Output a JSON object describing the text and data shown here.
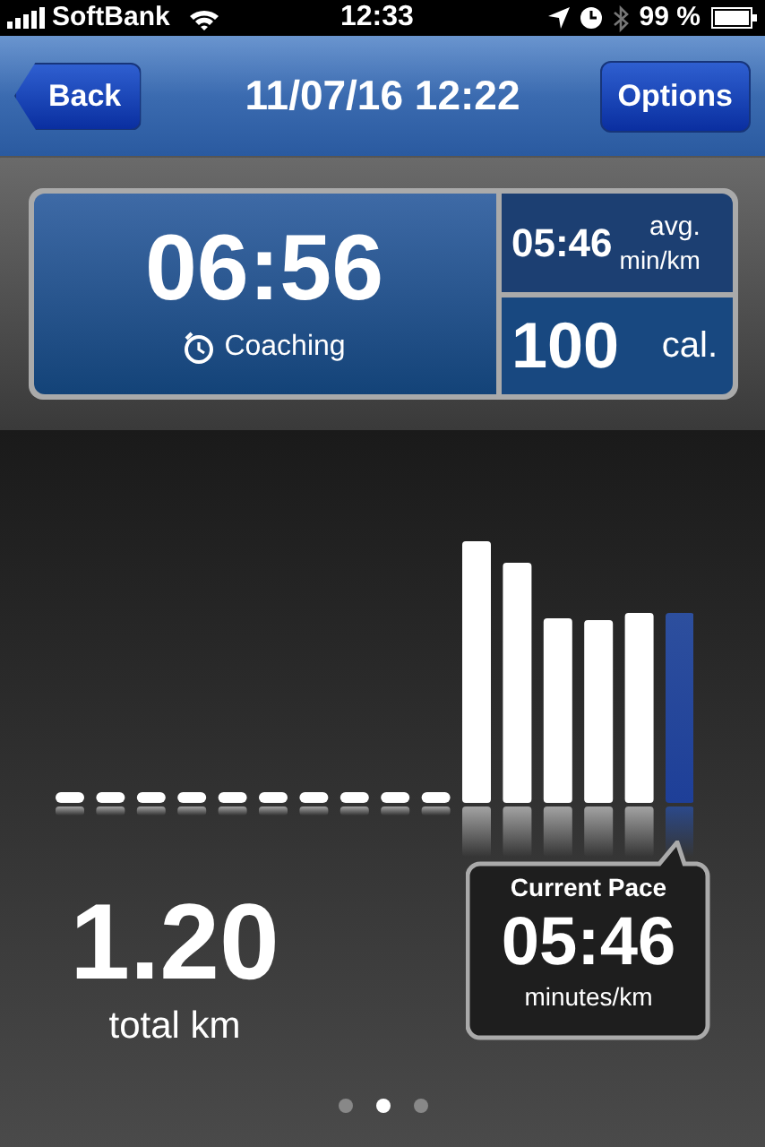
{
  "status_bar": {
    "carrier": "SoftBank",
    "time": "12:33",
    "battery": "99 %"
  },
  "nav_bar": {
    "back": "Back",
    "title": "11/07/16 12:22",
    "options": "Options"
  },
  "summary": {
    "duration": "06:56",
    "mode": "Coaching",
    "avg_pace": "05:46",
    "avg_pace_unit_1": "avg.",
    "avg_pace_unit_2": "min/km",
    "calories": "100",
    "calories_unit": "cal."
  },
  "distance": {
    "value": "1.20",
    "unit": "total km"
  },
  "current_pace": {
    "title": "Current Pace",
    "value": "05:46",
    "unit": "minutes/km"
  },
  "pages": [
    {
      "selected": false
    },
    {
      "selected": true
    },
    {
      "selected": false
    }
  ]
}
